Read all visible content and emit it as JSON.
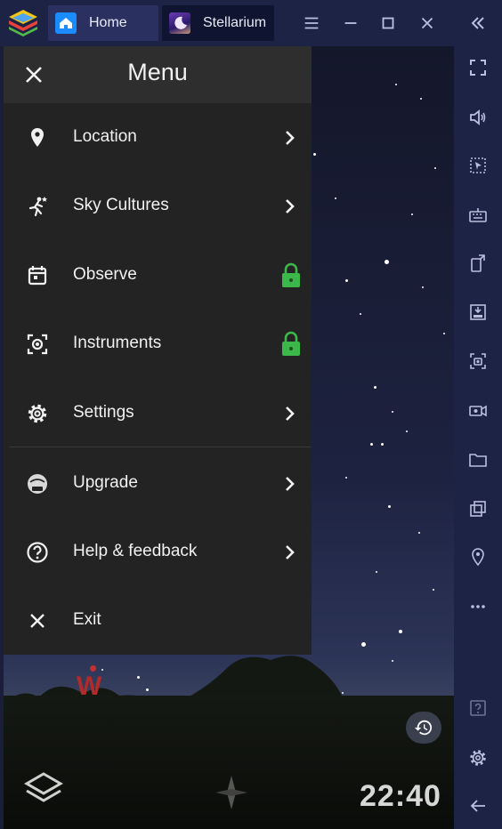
{
  "titlebar": {
    "tabs": [
      {
        "label": "Home",
        "icon": "home-icon"
      },
      {
        "label": "Stellarium",
        "icon": "stellarium-app-icon"
      }
    ],
    "controls": [
      "menu-icon",
      "minimize-icon",
      "maximize-icon",
      "close-icon",
      "collapse-sidebar-icon"
    ]
  },
  "menu": {
    "title": "Menu",
    "items": [
      {
        "label": "Location",
        "icon": "location-pin-icon",
        "trailing": "chevron"
      },
      {
        "label": "Sky Cultures",
        "icon": "sky-cultures-icon",
        "trailing": "chevron"
      },
      {
        "label": "Observe",
        "icon": "calendar-icon",
        "trailing": "lock"
      },
      {
        "label": "Instruments",
        "icon": "instruments-icon",
        "trailing": "lock"
      },
      {
        "label": "Settings",
        "icon": "gear-icon",
        "trailing": "chevron"
      },
      {
        "label": "Upgrade",
        "icon": "upgrade-icon",
        "trailing": "chevron"
      },
      {
        "label": "Help & feedback",
        "icon": "help-icon",
        "trailing": "chevron"
      },
      {
        "label": "Exit",
        "icon": "close-icon",
        "trailing": "none"
      }
    ]
  },
  "sky": {
    "direction_marker": "W",
    "clock": "22:40"
  },
  "colors": {
    "menu_bg": "#232323",
    "menu_header_bg": "#2e2e2e",
    "lock_green": "#3cb84a",
    "titlebar_bg": "#1d2345",
    "direction_red": "#b22a2a"
  },
  "rightbar": {
    "tools": [
      "fullscreen-icon",
      "volume-icon",
      "cursor-icon",
      "keyboard-icon",
      "rotate-icon",
      "apk-install-icon",
      "screenshot-icon",
      "record-icon",
      "folder-icon",
      "multi-instance-icon",
      "location-icon",
      "more-icon",
      "help-icon",
      "settings-icon",
      "back-icon"
    ]
  }
}
